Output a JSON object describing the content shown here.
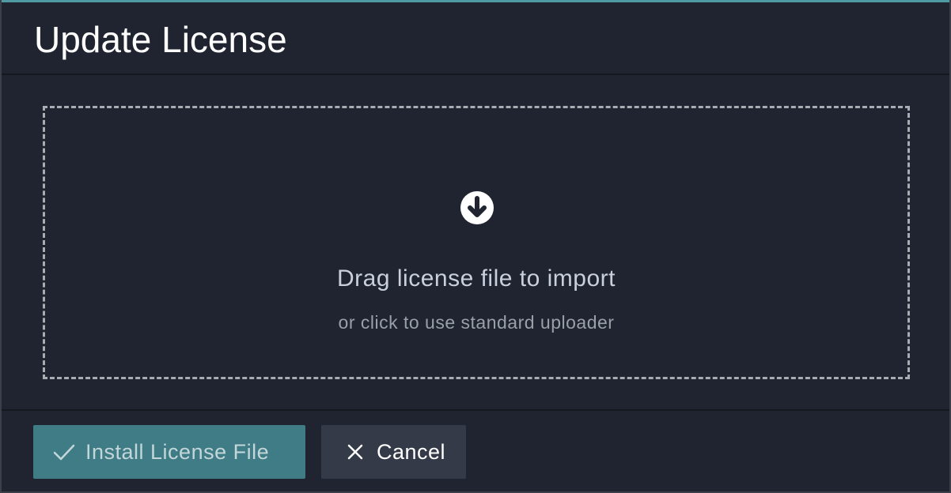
{
  "dialog": {
    "title": "Update License"
  },
  "dropzone": {
    "icon": "arrow-down-circle-icon",
    "title": "Drag license file to import",
    "subtitle": "or click to use standard uploader"
  },
  "footer": {
    "install_label": "Install License File",
    "install_icon": "checkmark-icon",
    "cancel_label": "Cancel",
    "cancel_icon": "close-icon"
  },
  "colors": {
    "accent": "#4f9aa3",
    "background": "#1f2430",
    "primary_button": "#3f7c86",
    "secondary_button": "#343a47"
  }
}
